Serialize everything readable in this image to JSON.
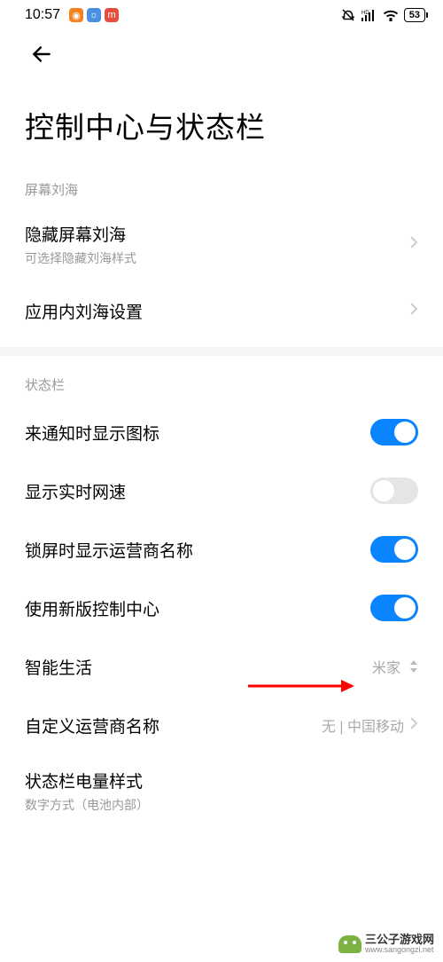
{
  "status_bar": {
    "time": "10:57",
    "battery": "53"
  },
  "page": {
    "title": "控制中心与状态栏"
  },
  "sections": {
    "notch": {
      "header": "屏幕刘海",
      "hide_notch": {
        "title": "隐藏屏幕刘海",
        "subtitle": "可选择隐藏刘海样式"
      },
      "app_notch": {
        "title": "应用内刘海设置"
      }
    },
    "status": {
      "header": "状态栏",
      "notif_icons": {
        "title": "来通知时显示图标",
        "on": true
      },
      "net_speed": {
        "title": "显示实时网速",
        "on": false
      },
      "carrier_lock": {
        "title": "锁屏时显示运营商名称",
        "on": true
      },
      "new_control": {
        "title": "使用新版控制中心",
        "on": true
      },
      "smart_life": {
        "title": "智能生活",
        "value": "米家"
      },
      "custom_carrier": {
        "title": "自定义运营商名称",
        "value": "无 | 中国移动"
      },
      "battery_style": {
        "title": "状态栏电量样式",
        "subtitle": "数字方式（电池内部）"
      }
    }
  },
  "watermark": {
    "line1": "三公子游戏网",
    "line2": "www.sangongzi.net"
  }
}
